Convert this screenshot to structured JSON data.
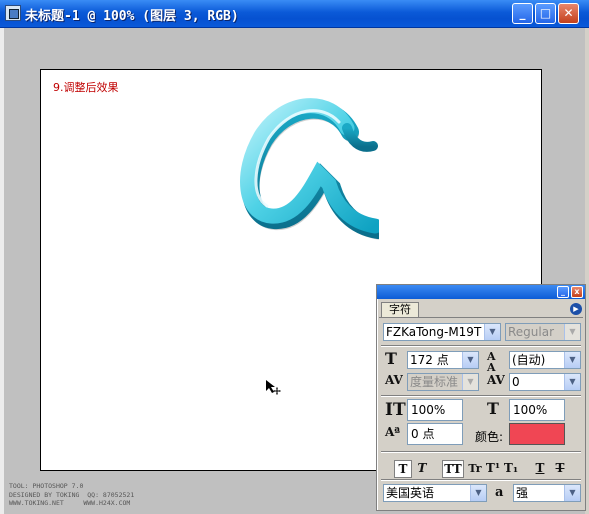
{
  "window": {
    "title": "未标题-1 @ 100% (图层 3, RGB)",
    "minimize_glyph": "_",
    "maximize_glyph": "□",
    "close_glyph": "✕"
  },
  "canvas": {
    "step_label": "9.调整后效果",
    "artwork_icon": "3d-letter-g-artwork",
    "artwork_color": "#2ec3d8",
    "cursor_icon": "move-cursor-icon"
  },
  "credits": {
    "line1": "TOOL: PHOTOSHOP 7.0",
    "line2": "DESIGNED BY TOKING  QQ: 87052521",
    "line3": "WWW.TOKING.NET     WWW.H24X.COM"
  },
  "char_panel": {
    "tab_label": "字符",
    "font_family": "FZKaTong-M19T",
    "font_style": "Regular",
    "font_size": "172 点",
    "leading": "(自动)",
    "kerning": "度量标准",
    "tracking": "0",
    "vertical_scale": "100%",
    "horizontal_scale": "100%",
    "baseline_shift": "0 点",
    "color_label": "颜色:",
    "color_value": "#f04654",
    "language": "美国英语",
    "antialias_icon_text": "a",
    "antialias": "强",
    "style_buttons": [
      "T",
      "T",
      "TT",
      "Tr",
      "T¹",
      "T₁",
      "T",
      "T"
    ]
  }
}
